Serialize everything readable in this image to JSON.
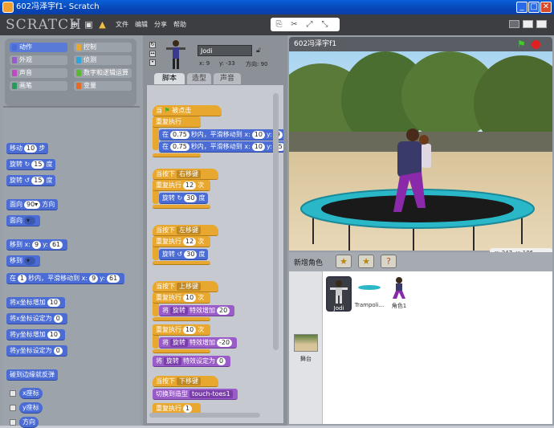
{
  "window": {
    "title": "602冯泽宇f1- Scratch"
  },
  "menu": {
    "logo": "SCRATCH",
    "items": [
      "文件",
      "编辑",
      "分享",
      "帮助"
    ]
  },
  "categories": [
    {
      "label": "动作",
      "color": "#4a6cd4",
      "selected": true
    },
    {
      "label": "控制",
      "color": "#e8a830"
    },
    {
      "label": "外观",
      "color": "#9a5cc8"
    },
    {
      "label": "侦测",
      "color": "#2aa6d8"
    },
    {
      "label": "声音",
      "color": "#c04ac0"
    },
    {
      "label": "数字和逻辑运算",
      "color": "#5ab830"
    },
    {
      "label": "画笔",
      "color": "#2a9a5a"
    },
    {
      "label": "变量",
      "color": "#e86a20"
    }
  ],
  "palette": {
    "move": {
      "text": "移动",
      "val": "10",
      "suffix": "步"
    },
    "turn_cw": {
      "text": "旋转",
      "val": "15",
      "suffix": "度"
    },
    "turn_ccw": {
      "text": "旋转",
      "val": "15",
      "suffix": "度"
    },
    "point_dir": {
      "text": "面向",
      "val": "90▾",
      "suffix": "方向"
    },
    "point_to": {
      "text": "面向"
    },
    "goto_xy": {
      "text": "移到 x:",
      "x": "9",
      "ylab": "y:",
      "y": "61"
    },
    "goto": {
      "text": "移到"
    },
    "glide": {
      "text": "在",
      "t": "1",
      "mid": "秒内，平滑移动到 x:",
      "x": "9",
      "ylab": "y:",
      "y": "61"
    },
    "change_x": {
      "text": "将x坐标增加",
      "val": "10"
    },
    "set_x": {
      "text": "将x坐标设定为",
      "val": "0"
    },
    "change_y": {
      "text": "将y坐标增加",
      "val": "10"
    },
    "set_y": {
      "text": "将y坐标设定为",
      "val": "0"
    },
    "bounce": {
      "text": "碰到边缘就反弹"
    },
    "rep_x": "x座标",
    "rep_y": "y座标",
    "rep_dir": "方向"
  },
  "sprite": {
    "name": "Jodi",
    "x": "x: 9",
    "y": "y: -33",
    "dir": "方向: 90"
  },
  "tabs": [
    "脚本",
    "造型",
    "声音"
  ],
  "scripts": {
    "s1_hat": "当",
    "s1_hat2": "被点击",
    "s1_forever": "重复执行",
    "s1_glide1": {
      "a": "在",
      "t": "0.75",
      "b": "秒内，平滑移动到 x:",
      "x": "10",
      "ylab": "y:",
      "y": "9"
    },
    "s1_glide2": {
      "a": "在",
      "t": "0.75",
      "b": "秒内，平滑移动到 x:",
      "x": "10",
      "ylab": "y:",
      "y": "-5"
    },
    "s2_hat": "当按下",
    "s2_key": "右移键",
    "s2_rep": "重复执行",
    "s2_n": "12",
    "s2_times": "次",
    "s2_turn": "旋转",
    "s2_deg": "30",
    "s2_unit": "度",
    "s3_hat": "当按下",
    "s3_key": "左移键",
    "s3_rep": "重复执行",
    "s3_n": "12",
    "s3_times": "次",
    "s3_turn": "旋转",
    "s3_deg": "30",
    "s3_unit": "度",
    "s4_hat": "当按下",
    "s4_key": "上移键",
    "s4_rep": "重复执行",
    "s4_n": "10",
    "s4_times": "次",
    "s4_eff": "将",
    "s4_eff_dd": "旋转",
    "s4_eff_b": "特效增加",
    "s4_eff_v": "20",
    "s4_rep2": "重复执行",
    "s4_n2": "10",
    "s4_times2": "次",
    "s4_eff2": "将",
    "s4_eff2_dd": "旋转",
    "s4_eff2_b": "特效增加",
    "s4_eff2_v": "-20",
    "s4_set": "将",
    "s4_set_dd": "旋转",
    "s4_set_b": "特效设定为",
    "s4_set_v": "0",
    "s5_hat": "当按下",
    "s5_key": "下移键",
    "s5_cos": "切换到造型",
    "s5_cos_dd": "touch-toes1",
    "s5_rep": "重复执行",
    "s5_n": "1"
  },
  "stage": {
    "title": "602冯泽宇f1",
    "coord_x": "x: 247",
    "coord_y": "y: 186"
  },
  "newsprite": {
    "label": "新增角色"
  },
  "sprites": [
    {
      "name": "Jodi"
    },
    {
      "name": "Trampoli..."
    },
    {
      "name": "角色1"
    }
  ],
  "stage_thumb": {
    "label": "舞台"
  }
}
